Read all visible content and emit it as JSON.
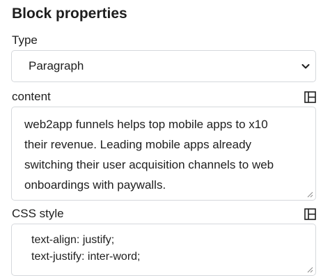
{
  "panel": {
    "title": "Block properties"
  },
  "type_field": {
    "label": "Type",
    "selected_value": "Paragraph",
    "chevron_icon": "chevron-down-icon"
  },
  "content_field": {
    "label": "content",
    "toggle_icon": "layout-panel-icon",
    "lines": [
      "web2app funnels helps top mobile apps to x10",
      "their revenue. Leading mobile apps already",
      "switching their user acquisition channels to web",
      "onboardings with paywalls."
    ]
  },
  "css_field": {
    "label": "CSS style",
    "toggle_icon": "layout-panel-icon",
    "lines": [
      "text-align: justify;",
      "text-justify: inter-word;"
    ]
  },
  "colors": {
    "text": "#1e1e1e",
    "border": "#d5d8dc",
    "background": "#ffffff"
  }
}
